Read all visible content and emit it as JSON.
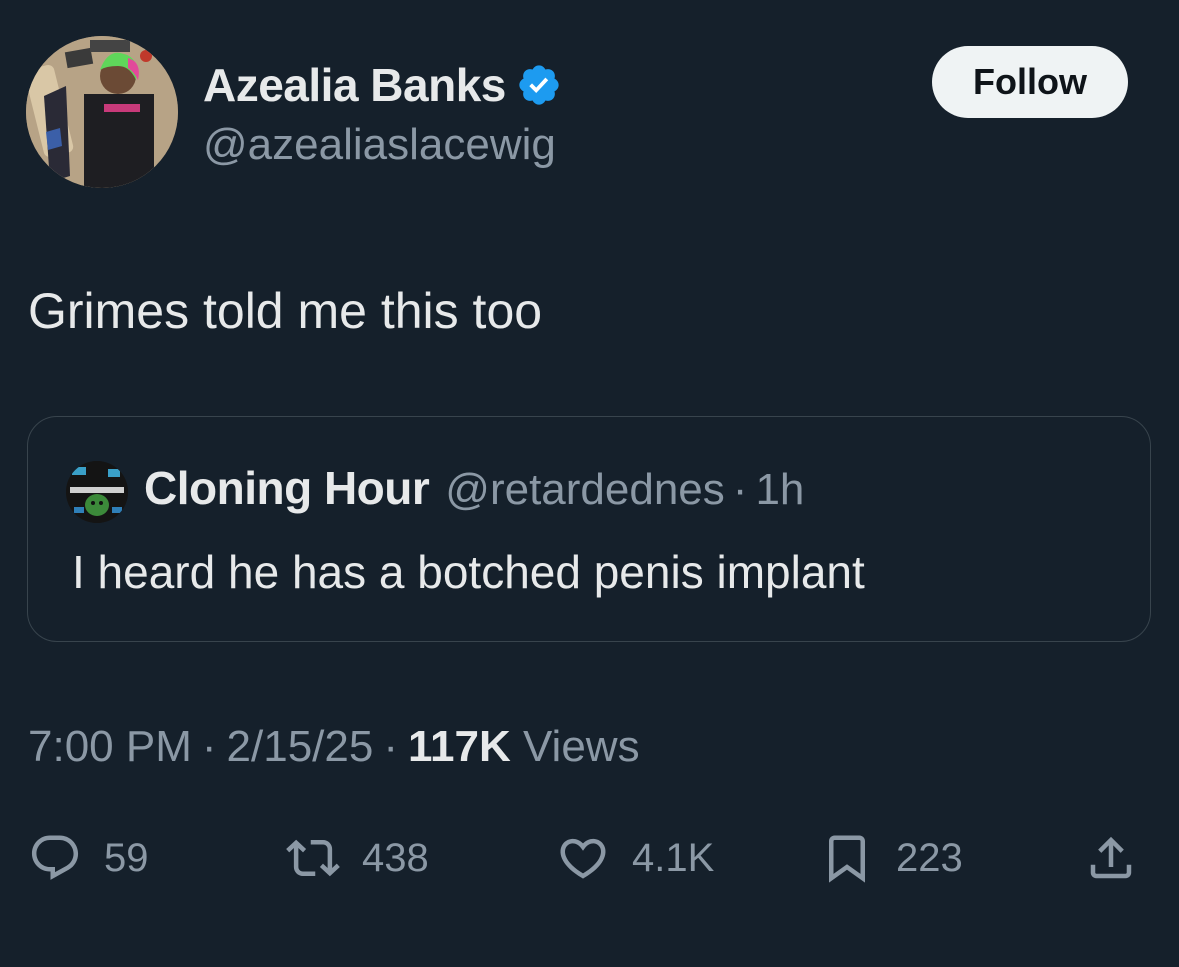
{
  "author": {
    "display_name": "Azealia Banks",
    "handle": "@azealiaslacewig",
    "verified": true,
    "verified_color": "#1d9bf0"
  },
  "follow_label": "Follow",
  "tweet_text": "Grimes told me this too",
  "quote": {
    "display_name": "Cloning Hour",
    "handle": "@retardednes",
    "separator": "·",
    "time": "1h",
    "text": "I heard he has a botched penis implant"
  },
  "meta": {
    "time": "7:00 PM",
    "date": "2/15/25",
    "separator": "·",
    "views_count": "117K",
    "views_label": "Views"
  },
  "actions": {
    "replies": "59",
    "reposts": "438",
    "likes": "4.1K",
    "bookmarks": "223"
  },
  "icons": {
    "reply": "reply-icon",
    "repost": "repost-icon",
    "like": "heart-icon",
    "bookmark": "bookmark-icon",
    "share": "share-icon"
  },
  "colors": {
    "background": "#15202b",
    "text_primary": "#e7e9ea",
    "text_secondary": "#8b98a5",
    "border": "#38444d",
    "follow_bg": "#eff3f4"
  }
}
